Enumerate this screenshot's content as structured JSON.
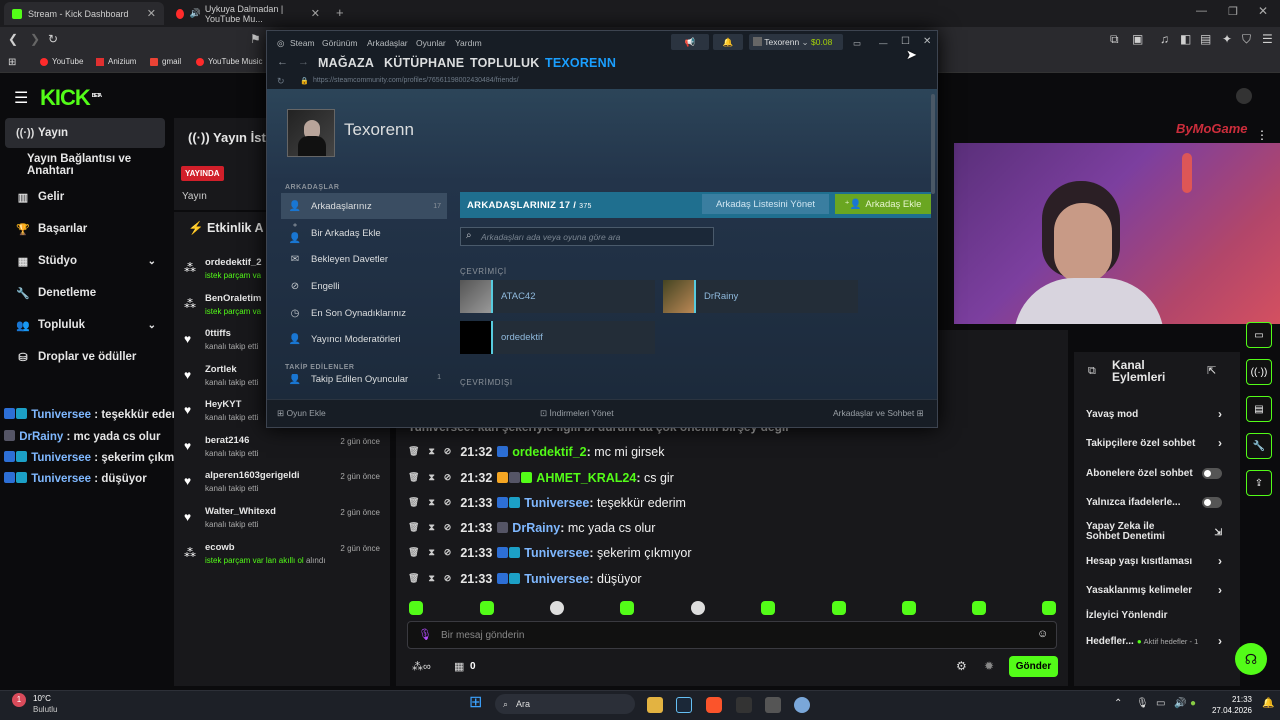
{
  "browser": {
    "tabs": [
      {
        "title": "Stream - Kick Dashboard"
      },
      {
        "title": "Uykuya Dalmadan | YouTube Mu..."
      }
    ],
    "bookmarks": [
      "YouTube",
      "Anizium",
      "gmail",
      "YouTube Music"
    ]
  },
  "kick": {
    "logo": "KICK",
    "logo_sup": "BETA",
    "sidebar": {
      "items": [
        {
          "label": "Yayın",
          "icon": "stream-icon",
          "selected": true
        },
        {
          "label": "Yayın Bağlantısı ve Anahtarı"
        },
        {
          "label": "Gelir",
          "icon": "chart-icon"
        },
        {
          "label": "Başarılar",
          "icon": "trophy-icon"
        },
        {
          "label": "Stüdyo",
          "icon": "studio-icon",
          "chevron": true
        },
        {
          "label": "Denetleme",
          "icon": "wrench-icon"
        },
        {
          "label": "Topluluk",
          "icon": "people-icon",
          "chevron": true
        },
        {
          "label": "Droplar ve ödüller",
          "icon": "gift-icon"
        }
      ]
    },
    "left_overlay_chat": [
      {
        "user": "Tuniversee",
        "text": "teşekkür ederim",
        "color": "#7fb8ff"
      },
      {
        "user": "DrRainy",
        "text": "mc yada cs olur",
        "color": "#7fb8ff"
      },
      {
        "user": "Tuniversee",
        "text": "şekerim çıkmıyor",
        "color": "#7fb8ff"
      },
      {
        "user": "Tuniversee",
        "text": "düşüyor",
        "color": "#7fb8ff"
      }
    ],
    "stream_header": {
      "title": "Yayın İsta",
      "live_badge": "YAYINDA",
      "sub": "Yayın"
    },
    "activity": {
      "title": "Etkinlik A",
      "items": [
        {
          "name": "ordedektif_2",
          "sub": "istek parçam va",
          "sub_green": true,
          "time": ""
        },
        {
          "name": "BenOraletim",
          "sub": "istek parçam va",
          "sub_green": true,
          "time": ""
        },
        {
          "name": "0ttiffs",
          "sub": "kanalı takip etti",
          "time": ""
        },
        {
          "name": "Zortlek",
          "sub": "kanalı takip etti",
          "time": ""
        },
        {
          "name": "HeyKYT",
          "sub": "kanalı takip etti",
          "time": ""
        },
        {
          "name": "berat2146",
          "sub": "kanalı takip etti",
          "time": "2 gün önce"
        },
        {
          "name": "alperen1603gerigeldi",
          "sub": "kanalı takip etti",
          "time": "2 gün önce"
        },
        {
          "name": "Walter_Whitexd",
          "sub": "kanalı takip etti",
          "time": "2 gün önce"
        },
        {
          "name": "ecowb",
          "sub": "istek parçam var lan akıllı ol",
          "sub_extra": "alındı",
          "sub_green": true,
          "time": "2 gün önce"
        }
      ]
    },
    "chat": {
      "partial_line": "Tuniversee: kan şekeriyle ilgili bi durum da çok önemli birşey değil",
      "lines": [
        {
          "time": "21:32",
          "user": "ordedektif_2",
          "sep": ":",
          "text": "mc mi girsek",
          "color": "#53fc18"
        },
        {
          "time": "21:32",
          "user": "AHMET_KRAL24",
          "sep": ":",
          "text": "cs gir",
          "color": "#53fc18"
        },
        {
          "time": "21:33",
          "user": "Tuniversee",
          "sep": ":",
          "text": "teşekkür ederim",
          "color": "#7fb8ff"
        },
        {
          "time": "21:33",
          "user": "DrRainy",
          "sep": ":",
          "text": "mc yada cs olur",
          "color": "#7fb8ff"
        },
        {
          "time": "21:33",
          "user": "Tuniversee",
          "sep": ":",
          "text": "şekerim çıkmıyor",
          "color": "#7fb8ff"
        },
        {
          "time": "21:33",
          "user": "Tuniversee",
          "sep": ":",
          "text": "düşüyor",
          "color": "#7fb8ff"
        }
      ],
      "input_placeholder": "Bir mesaj gönderin",
      "points": "0",
      "send_label": "Gönder"
    },
    "channel_actions": {
      "title": "Kanal Eylemleri",
      "items": [
        {
          "label": "Yavaş mod",
          "type": "chevron"
        },
        {
          "label": "Takipçilere özel sohbet",
          "type": "chevron"
        },
        {
          "label": "Abonelere özel sohbet",
          "type": "toggle"
        },
        {
          "label": "Yalnızca ifadelerle...",
          "type": "toggle"
        },
        {
          "label": "Yapay Zeka ile Sohbet Denetimi",
          "type": "external"
        },
        {
          "label": "Hesap yaşı kısıtlaması",
          "type": "chevron"
        },
        {
          "label": "Yasaklanmış kelimeler",
          "type": "chevron"
        },
        {
          "label": "İzleyici Yönlendir",
          "type": "none"
        },
        {
          "label": "Hedefler...",
          "type": "chevron",
          "extra": "Aktif hedefler - 1"
        }
      ]
    },
    "webcam_watermark": "ByMoGame"
  },
  "steam": {
    "menu": [
      "Steam",
      "Görünüm",
      "Arkadaşlar",
      "Oyunlar",
      "Yardım"
    ],
    "account": "Texorenn",
    "balance": "$0.08",
    "nav": [
      "MAĞAZA",
      "KÜTÜPHANE",
      "TOPLULUK",
      "TEXORENN"
    ],
    "url": "https://steamcommunity.com/profiles/76561198002430484/friends/",
    "profile_name": "Texorenn",
    "sidebar_header": "ARKADAŞLAR",
    "sidebar": [
      {
        "label": "Arkadaşlarınız",
        "count": "17",
        "icon": "person-icon"
      },
      {
        "label": "Bir Arkadaş Ekle",
        "icon": "person-add-icon"
      },
      {
        "label": "Bekleyen Davetler",
        "icon": "mail-icon"
      },
      {
        "label": "Engelli",
        "icon": "block-icon"
      },
      {
        "label": "En Son Oynadıklarınız",
        "icon": "clock-icon"
      },
      {
        "label": "Yayıncı Moderatörleri",
        "icon": "person-icon"
      }
    ],
    "sidebar_header2": "TAKİP EDİLENLER",
    "sidebar_partial": {
      "label": "Takip Edilen Oyuncular",
      "count": "1"
    },
    "friends_header": {
      "label": "ARKADAŞLARINIZ",
      "count": "17",
      "max": "375"
    },
    "manage_btn": "Arkadaş Listesini Yönet",
    "add_btn": "Arkadaş Ekle",
    "search_placeholder": "Arkadaşları ada veya oyuna göre ara",
    "online_label": "ÇEVRİMİÇİ",
    "offline_label": "ÇEVRİMDIŞI",
    "friends": [
      "ATAC42",
      "DrRainy",
      "ordedektif"
    ],
    "footer": {
      "add_game": "Oyun Ekle",
      "downloads": "İndirmeleri Yönet",
      "friends_chat": "Arkadaşlar ve Sohbet"
    }
  },
  "taskbar": {
    "weather_temp": "10°C",
    "weather_desc": "Bulutlu",
    "search": "Ara",
    "time": "21:33",
    "date": "27.04.2026"
  }
}
